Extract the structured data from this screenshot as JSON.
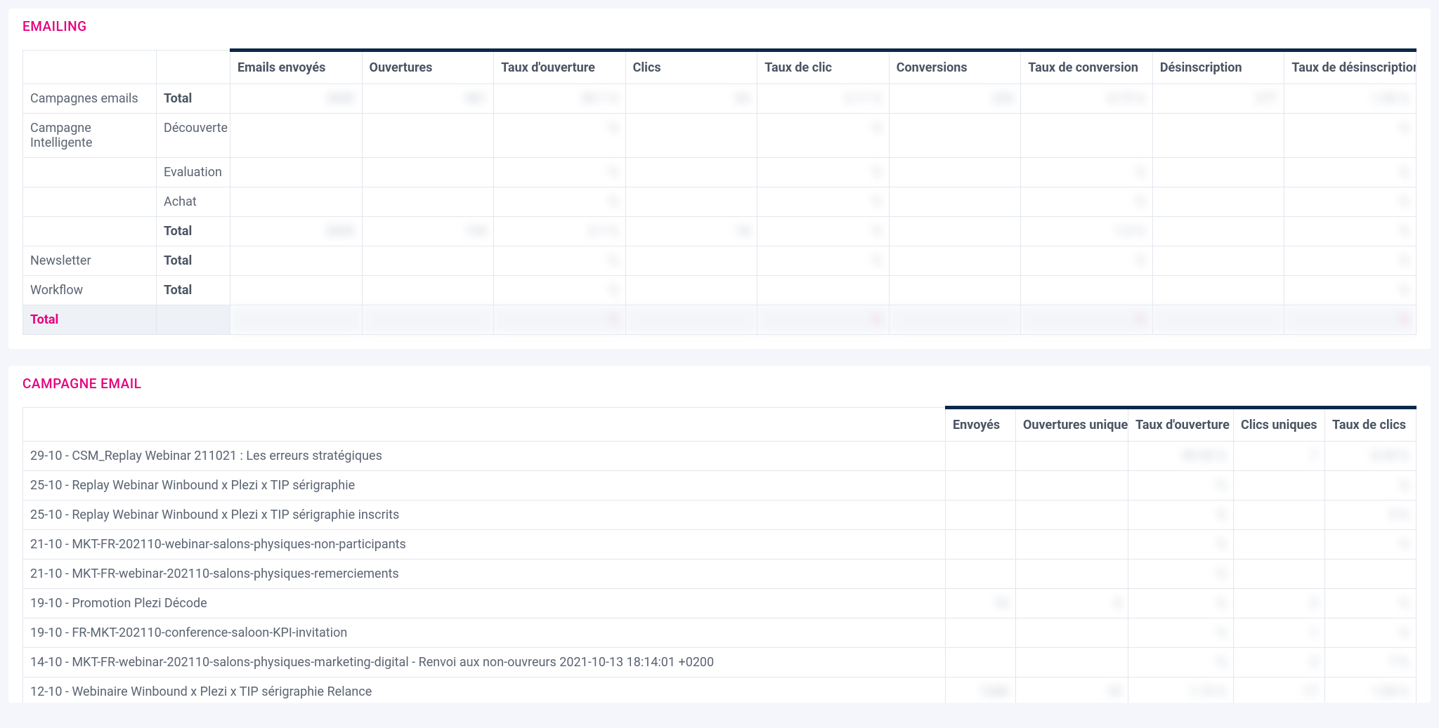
{
  "emailing": {
    "title": "EMAILING",
    "columns": [
      "Emails envoyés",
      "Ouvertures",
      "Taux d'ouverture",
      "Clics",
      "Taux de clic",
      "Conversions",
      "Taux de conversion",
      "Désinscription",
      "Taux de désinscription"
    ],
    "rows": [
      {
        "group": "Campagnes emails",
        "label": "Total",
        "bold_label": true,
        "values": [
          "2690",
          "981",
          "20.1 %",
          "63",
          "2.11 %",
          "220",
          "0.73 %",
          "277",
          "1.03 %"
        ]
      },
      {
        "group": "Campagne Intelligente",
        "label": "Découverte",
        "values": [
          "",
          "",
          "%",
          "",
          "%",
          "",
          "",
          "",
          "%"
        ]
      },
      {
        "group": "",
        "label": "Evaluation",
        "values": [
          "",
          "",
          "%",
          "",
          "%",
          "",
          "%",
          "",
          "%"
        ]
      },
      {
        "group": "",
        "label": "Achat",
        "values": [
          "",
          "",
          "%",
          "",
          "%",
          "",
          "%",
          "",
          "%"
        ]
      },
      {
        "group": "",
        "label": "Total",
        "bold_label": true,
        "values": [
          "3045",
          "134",
          "3.1 %",
          "18",
          "%",
          "",
          "1.0 %",
          "",
          "%"
        ]
      },
      {
        "group": "Newsletter",
        "label": "Total",
        "bold_label": true,
        "values": [
          "",
          "",
          "%",
          "",
          "%",
          "",
          "%",
          "",
          "%"
        ]
      },
      {
        "group": "Workflow",
        "label": "Total",
        "bold_label": true,
        "values": [
          "",
          "",
          "%",
          "",
          "",
          "",
          "",
          "",
          "%"
        ]
      }
    ],
    "total_label": "Total",
    "total_values": [
      "",
      "",
      "%",
      "",
      "%",
      "",
      "%",
      "",
      "%"
    ]
  },
  "campagne": {
    "title": "CAMPAGNE EMAIL",
    "columns": [
      "Envoyés",
      "Ouvertures uniques",
      "Taux d'ouverture",
      "Clics uniques",
      "Taux de clics"
    ],
    "rows": [
      {
        "name": "29-10 - CSM_Replay Webinar 211021 : Les erreurs stratégiques",
        "values": [
          "",
          "",
          "49.43 %",
          "7",
          "8.35 %"
        ]
      },
      {
        "name": "25-10 - Replay Webinar Winbound x Plezi x TIP sérigraphie",
        "values": [
          "",
          "",
          "%",
          "",
          "%"
        ]
      },
      {
        "name": "25-10 - Replay Webinar Winbound x Plezi x TIP sérigraphie inscrits",
        "values": [
          "",
          "",
          "%",
          "",
          "9 %"
        ]
      },
      {
        "name": "21-10 - MKT-FR-202110-webinar-salons-physiques-non-participants",
        "values": [
          "",
          "",
          "%",
          "",
          "%"
        ]
      },
      {
        "name": "21-10 - MKT-FR-webinar-202110-salons-physiques-remerciements",
        "values": [
          "",
          "",
          "%",
          "",
          ""
        ]
      },
      {
        "name": "19-10 - Promotion Plezi Décode",
        "values": [
          "16",
          "4",
          "%",
          "2",
          "%"
        ]
      },
      {
        "name": "19-10 - FR-MKT-202110-conference-saloon-KPI-invitation",
        "values": [
          "",
          "",
          "%",
          "1",
          "%"
        ]
      },
      {
        "name": "14-10 - MKT-FR-webinar-202110-salons-physiques-marketing-digital - Renvoi aux non-ouvreurs 2021-10-13 18:14:01 +0200",
        "values": [
          "",
          "",
          "%",
          "2",
          "7 %"
        ]
      },
      {
        "name": "12-10 - Webinaire Winbound x Plezi x TIP sérigraphie Relance",
        "values": [
          "1048",
          "18",
          "1.73 %",
          "17",
          "1.03 %"
        ]
      }
    ]
  }
}
